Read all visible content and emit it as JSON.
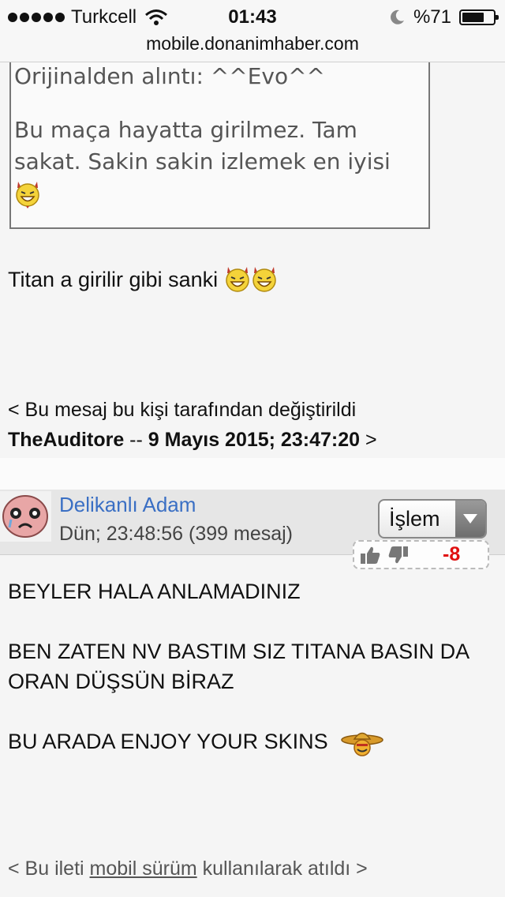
{
  "status_bar": {
    "carrier": "Turkcell",
    "time": "01:43",
    "battery": "%71",
    "battery_level": 0.71,
    "url": "mobile.donanimhaber.com"
  },
  "quote": {
    "header": "Orijinalden alıntı: ^^Evo^^",
    "body": "Bu maça hayatta girilmez. Tam sakat. Sakin sakin izlemek en iyisi"
  },
  "post1": {
    "text": "Titan a girilir gibi sanki",
    "edit_prefix": "< Bu mesaj bu kişi tarafından değiştirildi",
    "edit_user": "TheAuditore",
    "edit_sep": " -- ",
    "edit_date": "9 Mayıs 2015; 23:47:20",
    "edit_suffix": " >"
  },
  "post2": {
    "username": "Delikanlı Adam",
    "datetime": "Dün; 23:48:56 (399 mesaj)",
    "action_label": "İşlem",
    "score": "-8",
    "lines": [
      "BEYLER HALA ANLAMADINIZ",
      "",
      "BEN ZATEN NV BASTIM SIZ TITANA BASIN DA ORAN DÜŞSÜN BİRAZ",
      "",
      "BU ARADA ENJOY YOUR SKINS"
    ],
    "footer_prefix": "< Bu ileti ",
    "footer_link": "mobil sürüm",
    "footer_suffix": " kullanılarak atıldı >"
  },
  "icons": {
    "signal": "signal-dots-icon",
    "wifi": "wifi-icon",
    "moon": "do-not-disturb-moon-icon",
    "battery": "battery-icon",
    "devil_smiley": "devil-smiley-icon",
    "sombrero_smiley": "sombrero-smiley-icon",
    "thumbs_up": "thumbs-up-icon",
    "thumbs_down": "thumbs-down-icon"
  },
  "colors": {
    "username": "#3a6fc4",
    "score": "#e01010",
    "header_band": "#e6e6e6"
  }
}
